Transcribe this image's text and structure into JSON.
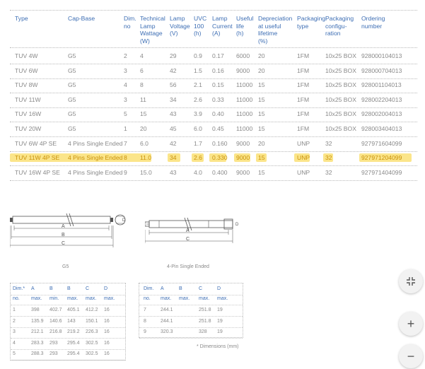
{
  "spec_table": {
    "headers": [
      {
        "key": "type",
        "lines": [
          "Type"
        ]
      },
      {
        "key": "cap",
        "lines": [
          "Cap-Base"
        ]
      },
      {
        "key": "dim",
        "lines": [
          "Dim.",
          "no"
        ]
      },
      {
        "key": "watt",
        "lines": [
          "Technical",
          "Lamp",
          "Wattage",
          "(W)"
        ]
      },
      {
        "key": "volt",
        "lines": [
          "Lamp",
          "Voltage",
          "",
          "(V)"
        ]
      },
      {
        "key": "uvc",
        "lines": [
          "UVC",
          "100",
          "",
          "(h)"
        ]
      },
      {
        "key": "cur",
        "lines": [
          "Lamp",
          "Current",
          "",
          "(A)"
        ]
      },
      {
        "key": "life",
        "lines": [
          "Useful",
          "life",
          "",
          "(h)"
        ]
      },
      {
        "key": "dep",
        "lines": [
          "Depreciation",
          "at useful",
          "lifetime",
          "(%)"
        ]
      },
      {
        "key": "pack",
        "lines": [
          "Packaging",
          "type"
        ]
      },
      {
        "key": "conf",
        "lines": [
          "Packaging",
          "configu-",
          "ration"
        ]
      },
      {
        "key": "order",
        "lines": [
          "Ordering",
          "number"
        ]
      }
    ],
    "rows": [
      [
        "TUV 4W",
        "G5",
        "2",
        "4",
        "29",
        "0.9",
        "0.17",
        "6000",
        "20",
        "1FM",
        "10x25 BOX",
        "928000104013"
      ],
      [
        "TUV 6W",
        "G5",
        "3",
        "6",
        "42",
        "1.5",
        "0.16",
        "9000",
        "20",
        "1FM",
        "10x25 BOX",
        "928000704013"
      ],
      [
        "TUV 8W",
        "G5",
        "4",
        "8",
        "56",
        "2.1",
        "0.15",
        "11000",
        "15",
        "1FM",
        "10x25 BOX",
        "928001104013"
      ],
      [
        "TUV 11W",
        "G5",
        "3",
        "11",
        "34",
        "2.6",
        "0.33",
        "11000",
        "15",
        "1FM",
        "10x25 BOX",
        "928002204013"
      ],
      [
        "TUV 16W",
        "G5",
        "5",
        "15",
        "43",
        "3.9",
        "0.40",
        "11000",
        "15",
        "1FM",
        "10x25 BOX",
        "928002004013"
      ],
      [
        "TUV 20W",
        "G5",
        "1",
        "20",
        "45",
        "6.0",
        "0.45",
        "11000",
        "15",
        "1FM",
        "10x25 BOX",
        "928003404013"
      ],
      [
        "TUV 6W 4P SE",
        "4 Pins Single Ended",
        "7",
        "6.0",
        "42",
        "1.7",
        "0.160",
        "9000",
        "20",
        "UNP",
        "32",
        "927971604099"
      ],
      [
        "TUV 11W 4P SE",
        "4 Pins Single Ended",
        "8",
        "11.0",
        "34",
        "2.6",
        "0.330",
        "9000",
        "15",
        "UNP",
        "32",
        "927971204099"
      ],
      [
        "TUV 16W 4P SE",
        "4 Pins Single Ended",
        "9",
        "15.0",
        "43",
        "4.0",
        "0.400",
        "9000",
        "15",
        "UNP",
        "32",
        "927971404099"
      ]
    ],
    "highlighted_row": 7
  },
  "drawings": {
    "g5": {
      "caption": "G5",
      "labels": [
        "A",
        "B",
        "C",
        "D"
      ]
    },
    "four_pin": {
      "caption": "4-Pin Single Ended",
      "labels": [
        "A",
        "C",
        "D"
      ]
    }
  },
  "dim_table_left": {
    "header1": [
      "Dim.*",
      "A",
      "B",
      "B",
      "C",
      "D"
    ],
    "header2": [
      "no.",
      "max.",
      "min.",
      "max.",
      "max.",
      "max."
    ],
    "rows": [
      [
        "1",
        "398",
        "402.7",
        "405.1",
        "412.2",
        "16"
      ],
      [
        "2",
        "135.9",
        "140.6",
        "143",
        "150.1",
        "16"
      ],
      [
        "3",
        "212.1",
        "216.8",
        "219.2",
        "226.3",
        "16"
      ],
      [
        "4",
        "283.3",
        "293",
        "295.4",
        "302.5",
        "16"
      ],
      [
        "5",
        "288.3",
        "293",
        "295.4",
        "302.5",
        "16"
      ]
    ]
  },
  "dim_table_right": {
    "header1": [
      "Dim.",
      "A",
      "B",
      "C",
      "D"
    ],
    "header2": [
      "no.",
      "max.",
      "max.",
      "max.",
      "max."
    ],
    "rows": [
      [
        "7",
        "244.1",
        "",
        "251.8",
        "19"
      ],
      [
        "8",
        "244.1",
        "",
        "251.8",
        "19"
      ],
      [
        "9",
        "320.3",
        "",
        "328",
        "19"
      ]
    ],
    "footnote": "* Dimensions (mm)"
  },
  "controls": {
    "fit_icon": "collapse-arrows-icon",
    "zoom_in_label": "+",
    "zoom_out_label": "−"
  },
  "colors": {
    "accent": "#3d6eb4",
    "highlight": "#fbe58a",
    "highlight_text": "#c9910a"
  }
}
